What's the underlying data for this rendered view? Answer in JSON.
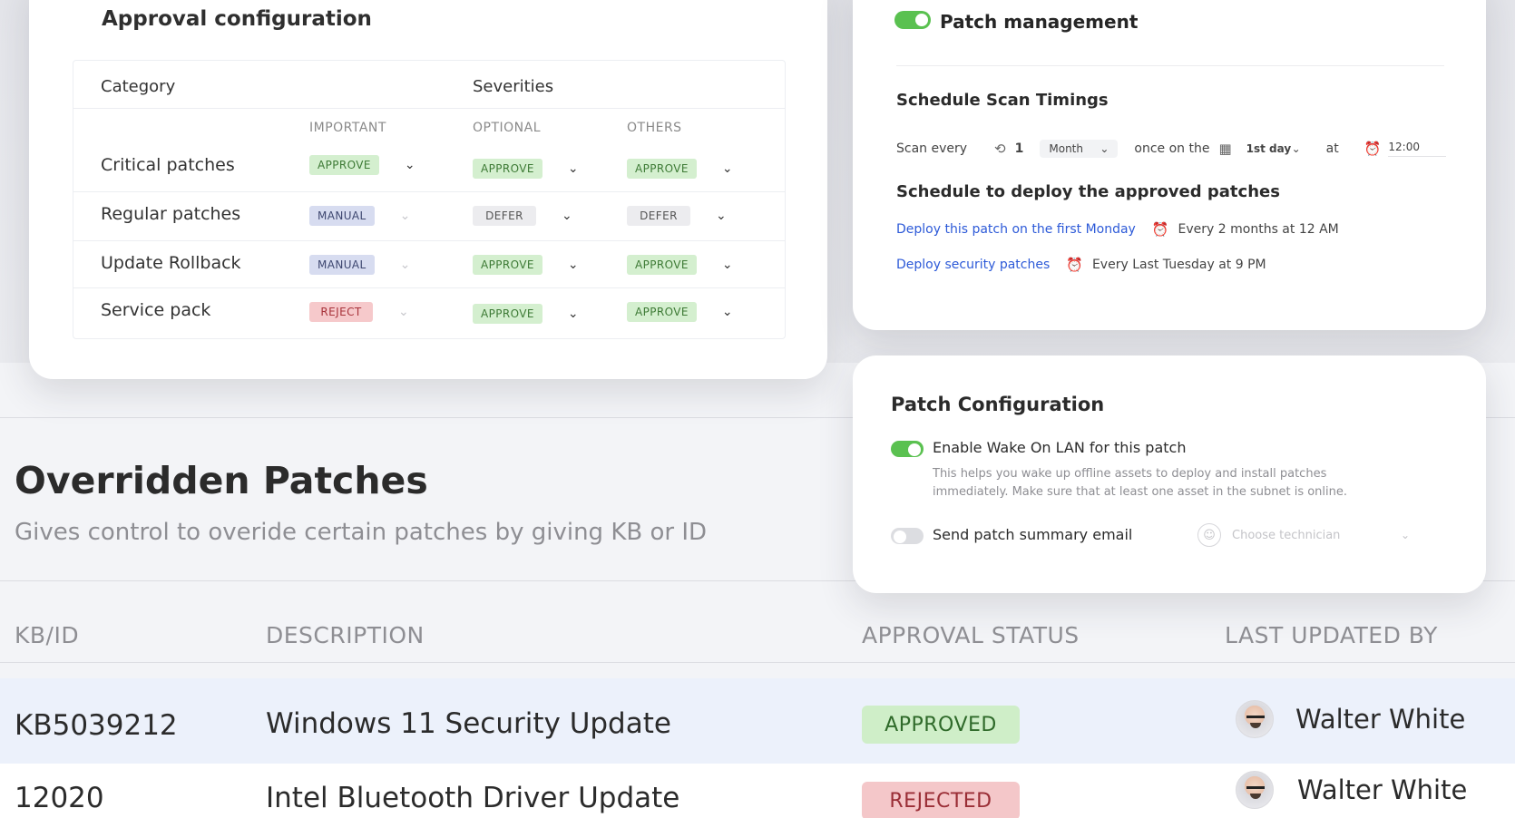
{
  "approval": {
    "title": "Approval configuration",
    "category_header": "Category",
    "severities_header": "Severities",
    "columns": [
      "IMPORTANT",
      "OPTIONAL",
      "OTHERS"
    ],
    "rows": [
      {
        "label": "Critical patches",
        "important": "APPROVE",
        "optional": "APPROVE",
        "others": "APPROVE"
      },
      {
        "label": "Regular patches",
        "important": "MANUAL",
        "optional": "DEFER",
        "others": "DEFER"
      },
      {
        "label": "Update Rollback",
        "important": "MANUAL",
        "optional": "APPROVE",
        "others": "APPROVE"
      },
      {
        "label": "Service pack",
        "important": "REJECT",
        "optional": "APPROVE",
        "others": "APPROVE"
      }
    ]
  },
  "patch_management": {
    "title": "Patch management",
    "enabled": true,
    "scan_title": "Schedule Scan Timings",
    "scan": {
      "label_every": "Scan every",
      "interval": "1",
      "unit": "Month",
      "label_once": "once on the",
      "day": "1st day",
      "label_at": "at",
      "time": "12:00"
    },
    "deploy_title": "Schedule to deploy the approved patches",
    "deploy": [
      {
        "link": "Deploy this patch on the first Monday",
        "schedule": "Every 2 months at 12 AM"
      },
      {
        "link": "Deploy security patches",
        "schedule": "Every Last Tuesday at 9 PM"
      }
    ]
  },
  "patch_config": {
    "title": "Patch Configuration",
    "wol_label": "Enable Wake On LAN for this patch",
    "wol_enabled": true,
    "wol_desc": "This helps you wake up offline assets to deploy and install patches immediately. Make sure that at least one asset in the subnet is online.",
    "email_label": "Send patch summary email",
    "email_enabled": false,
    "technician_placeholder": "Choose technician"
  },
  "overridden": {
    "title": "Overridden Patches",
    "subtitle": "Gives control to overide certain patches by giving KB or ID",
    "headers": {
      "kb": "KB/ID",
      "description": "DESCRIPTION",
      "status": "APPROVAL STATUS",
      "updated_by": "LAST UPDATED BY"
    },
    "rows": [
      {
        "kb": "KB5039212",
        "description": "Windows 11  Security Update",
        "status": "APPROVED",
        "updated_by": "Walter White"
      },
      {
        "kb": "12020",
        "description": "Intel Bluetooth Driver Update",
        "status": "REJECTED",
        "updated_by": "Walter White"
      }
    ]
  },
  "colors": {
    "approve": "#d4efcf",
    "manual": "#d7dcf0",
    "defer": "#ececef",
    "reject": "#f6c9cb",
    "toggle_on": "#5ac150",
    "link": "#2d5ad8"
  }
}
